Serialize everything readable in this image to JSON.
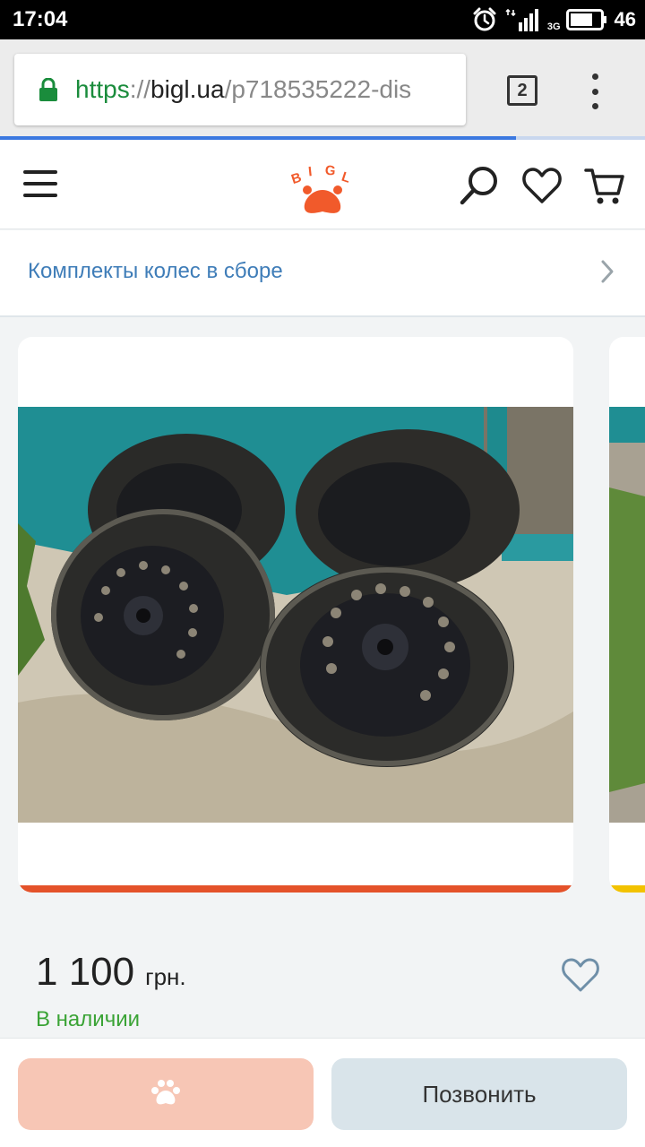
{
  "status_bar": {
    "time": "17:04",
    "network": "3G",
    "battery": "46",
    "icons": [
      "alarm-icon",
      "signal-icon",
      "battery-icon"
    ]
  },
  "browser": {
    "url_scheme": "https",
    "url_separator": "://",
    "url_host": "bigl.ua",
    "url_path": "/p718535222-dis",
    "tab_count": "2",
    "load_progress": 0.8,
    "icons": [
      "lock-icon",
      "more-vert-icon"
    ]
  },
  "header": {
    "logo_text": "BIGL",
    "icons": [
      "menu-icon",
      "bigl-logo",
      "search-icon",
      "heart-icon",
      "cart-icon"
    ]
  },
  "category": {
    "label": "Комплекты колес в сборе",
    "icon": "chevron-right-icon"
  },
  "product": {
    "image_alt": "four steel wheels with tires leaning against a teal wall",
    "price_value": "1 100",
    "price_currency": "грн.",
    "availability": "В наличии"
  },
  "actions": {
    "buy_icon": "paw-icon",
    "call_label": "Позвонить"
  },
  "colors": {
    "accent_orange": "#f15a2b",
    "link_blue": "#3f7db8",
    "available_green": "#3aa335",
    "url_green": "#1a8c3c",
    "progress_blue": "#3b78e0",
    "buy_button": "#f7c6b5",
    "call_button": "#d9e4ea"
  }
}
